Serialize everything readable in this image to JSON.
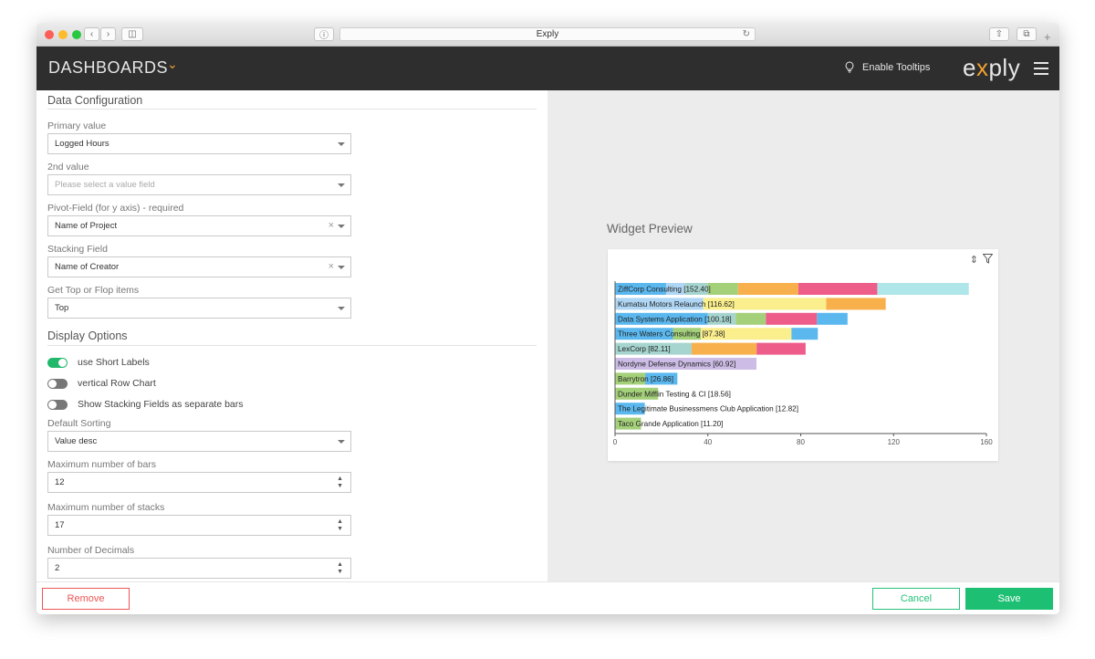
{
  "browser": {
    "url_title": "Exply",
    "traffic_lights": [
      "#fc5f57",
      "#fdbc2e",
      "#28c840"
    ]
  },
  "header": {
    "title": "DASHBOARDS",
    "tooltips_label": "Enable Tooltips",
    "logo_prefix": "e",
    "logo_x": "x",
    "logo_suffix": "ply"
  },
  "config": {
    "section_title": "Data Configuration",
    "fields": [
      {
        "label": "Primary value",
        "value": "Logged Hours",
        "placeholder": false,
        "clearable": false
      },
      {
        "label": "2nd value",
        "value": "Please select a value field",
        "placeholder": true,
        "clearable": false
      },
      {
        "label": "Pivot-Field (for y axis) - required",
        "value": "Name of Project",
        "placeholder": false,
        "clearable": true
      },
      {
        "label": "Stacking Field",
        "value": "Name of Creator",
        "placeholder": false,
        "clearable": true
      },
      {
        "label": "Get Top or Flop items",
        "value": "Top",
        "placeholder": false,
        "clearable": false
      }
    ]
  },
  "display": {
    "section_title": "Display Options",
    "toggles": [
      {
        "label": "use Short Labels",
        "on": true
      },
      {
        "label": "vertical Row Chart",
        "on": false
      },
      {
        "label": "Show Stacking Fields as separate bars",
        "on": false
      }
    ],
    "sorting_label": "Default Sorting",
    "sorting_value": "Value desc",
    "max_bars_label": "Maximum number of bars",
    "max_bars_value": "12",
    "max_stacks_label": "Maximum number of stacks",
    "max_stacks_value": "17",
    "decimals_label": "Number of Decimals",
    "decimals_value": "2"
  },
  "preview": {
    "title": "Widget Preview"
  },
  "footer": {
    "remove": "Remove",
    "cancel": "Cancel",
    "save": "Save"
  },
  "colors": {
    "accent_orange": "#f0a030",
    "green": "#1dbf73",
    "remove_red": "#e55555"
  },
  "chart_data": {
    "type": "bar",
    "orientation": "horizontal",
    "stacked": true,
    "xlim": [
      0,
      160
    ],
    "x_ticks": [
      0,
      40,
      80,
      120,
      160
    ],
    "stack_colors": [
      "#5bb8ef",
      "#afd7f5",
      "#a6d4cf",
      "#a4d07a",
      "#fbee8c",
      "#f7b04b",
      "#ee5c8a",
      "#aee6ea",
      "#cdbde6"
    ],
    "bars": [
      {
        "label": "ZiffCorp Consulting [152.40]",
        "total": 152.4,
        "segments": [
          {
            "c": 0,
            "v": 22
          },
          {
            "c": 1,
            "v": 8
          },
          {
            "c": 2,
            "v": 10
          },
          {
            "c": 3,
            "v": 13
          },
          {
            "c": 5,
            "v": 26
          },
          {
            "c": 6,
            "v": 34
          },
          {
            "c": 7,
            "v": 39.4
          }
        ]
      },
      {
        "label": "Kumatsu Motors Relaunch [116.62]",
        "total": 116.62,
        "segments": [
          {
            "c": 1,
            "v": 38
          },
          {
            "c": 4,
            "v": 53
          },
          {
            "c": 5,
            "v": 25.62
          }
        ]
      },
      {
        "label": "Data Systems Application [100.18]",
        "total": 100.18,
        "segments": [
          {
            "c": 0,
            "v": 40
          },
          {
            "c": 2,
            "v": 12
          },
          {
            "c": 3,
            "v": 13
          },
          {
            "c": 6,
            "v": 22
          },
          {
            "c": 0,
            "v": 13.18
          }
        ]
      },
      {
        "label": "Three Waters Consulting [87.38]",
        "total": 87.38,
        "segments": [
          {
            "c": 0,
            "v": 25
          },
          {
            "c": 3,
            "v": 12
          },
          {
            "c": 4,
            "v": 39
          },
          {
            "c": 0,
            "v": 11.38
          }
        ]
      },
      {
        "label": "LexCorp [82.11]",
        "total": 82.11,
        "segments": [
          {
            "c": 2,
            "v": 33
          },
          {
            "c": 5,
            "v": 28
          },
          {
            "c": 6,
            "v": 21.11
          }
        ]
      },
      {
        "label": "Nordyne Defense Dynamics [60.92]",
        "total": 60.92,
        "segments": [
          {
            "c": 8,
            "v": 60.92
          }
        ]
      },
      {
        "label": "Barrytron [26.86]",
        "total": 26.86,
        "segments": [
          {
            "c": 3,
            "v": 13
          },
          {
            "c": 0,
            "v": 13.86
          }
        ]
      },
      {
        "label": "Dunder Mifflin Testing & CI [18.56]",
        "total": 18.56,
        "segments": [
          {
            "c": 3,
            "v": 18.56
          }
        ]
      },
      {
        "label": "The Legitimate Businessmens Club Application [12.82]",
        "total": 12.82,
        "segments": [
          {
            "c": 0,
            "v": 12.82
          }
        ]
      },
      {
        "label": "Taco Grande Application [11.20]",
        "total": 11.2,
        "segments": [
          {
            "c": 3,
            "v": 11.2
          }
        ]
      }
    ]
  }
}
